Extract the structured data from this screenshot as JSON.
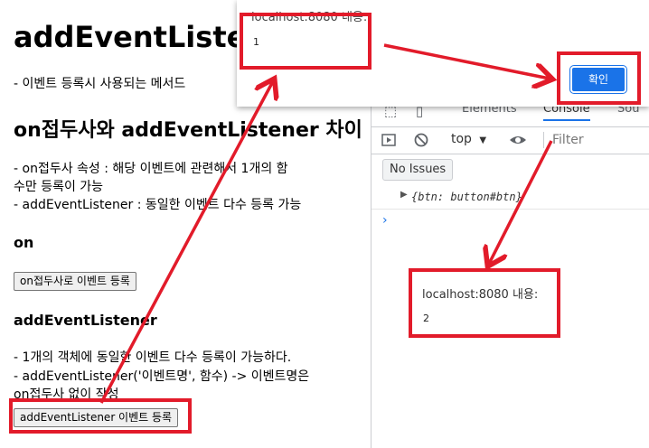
{
  "page": {
    "title": "addEventListener",
    "desc": "- 이벤트 등록시 사용되는 메서드",
    "section_title": "on접두사와 addEventListener 차이",
    "diff_line1a": "- on접두사 속성 : 해당 이벤트에 관련해서 1개의 함",
    "diff_line1b": "수만 등록이 가능",
    "diff_line2": "- addEventListener : 동일한 이벤트 다수 등록 가능",
    "on_heading": "on",
    "on_button": "on접두사로 이벤트 등록",
    "ael_heading": "addEventListener",
    "ael_line1": "- 1개의 객체에 동일한 이벤트 다수 등록이 가능하다.",
    "ael_line2": "- addEventListener('이벤트명', 함수) -> 이벤트명은",
    "ael_line3": "on접두사 없이 작성",
    "ael_button": "addEventListener 이벤트 등록"
  },
  "devtools": {
    "tabs": [
      "Elements",
      "Console",
      "Sou"
    ],
    "active_tab": "Console",
    "context": "top",
    "filter_placeholder": "Filter",
    "issues": "No Issues",
    "log_entry": "{btn: button#btn}",
    "icons": [
      "sidebar-toggle-icon",
      "clear-console-icon",
      "context-dropdown-icon",
      "eye-icon"
    ]
  },
  "alert_top": {
    "origin": "localhost:8080 내용:",
    "message": "1",
    "confirm": "확인"
  },
  "alert_second": {
    "origin": "localhost:8080 내용:",
    "message": "2"
  },
  "colors": {
    "annotation": "#e21b2a",
    "accent": "#1a73e8"
  }
}
